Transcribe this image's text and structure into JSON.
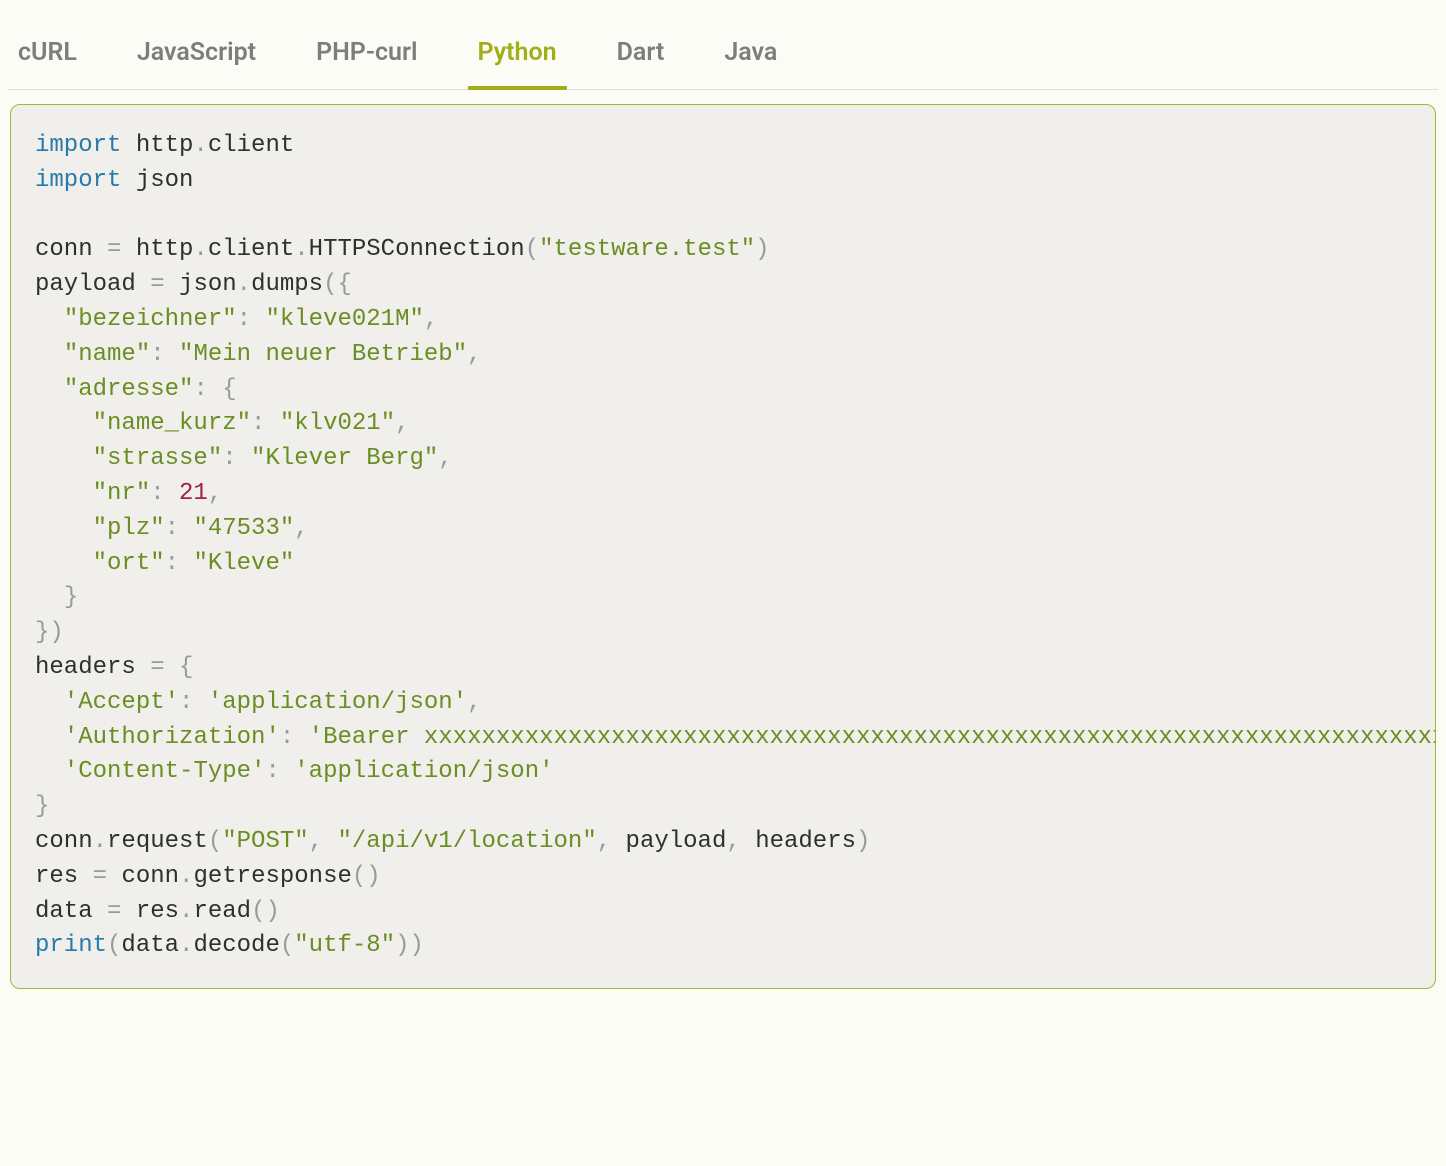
{
  "tabs": [
    {
      "label": "cURL",
      "active": false
    },
    {
      "label": "JavaScript",
      "active": false
    },
    {
      "label": "PHP-curl",
      "active": false
    },
    {
      "label": "Python",
      "active": true
    },
    {
      "label": "Dart",
      "active": false
    },
    {
      "label": "Java",
      "active": false
    }
  ],
  "code": {
    "host": "testware.test",
    "method": "POST",
    "path": "/api/v1/location",
    "encoding": "utf-8",
    "payload": {
      "bezeichner": "kleve021M",
      "name": "Mein neuer Betrieb",
      "adresse": {
        "name_kurz": "klv021",
        "strasse": "Klever Berg",
        "nr": 21,
        "plz": "47533",
        "ort": "Kleve"
      }
    },
    "headers": {
      "accept_key": "Accept",
      "accept_val": "application/json",
      "auth_key": "Authorization",
      "auth_val": "Bearer xxxxxxxxxxxxxxxxxxxxxxxxxxxxxxxxxxxxxxxxxxxxxxxxxxxxxxxxxxxxxxxxxxxxxxxxxxxxxxxxxxxxxxxxxxxxxxxxxxxxxxx",
      "ctype_key": "Content-Type",
      "ctype_val": "application/json"
    },
    "kw_import1": "import",
    "kw_import2": "import",
    "kw_print": "print",
    "mod_http": "http",
    "mod_client": "client",
    "mod_json": "json",
    "id_conn": "conn",
    "id_payload": "payload",
    "id_headers": "headers",
    "id_res": "res",
    "id_data": "data",
    "fn_https": "HTTPSConnection",
    "fn_dumps": "dumps",
    "fn_request": "request",
    "fn_getresponse": "getresponse",
    "fn_read": "read",
    "fn_decode": "decode"
  }
}
